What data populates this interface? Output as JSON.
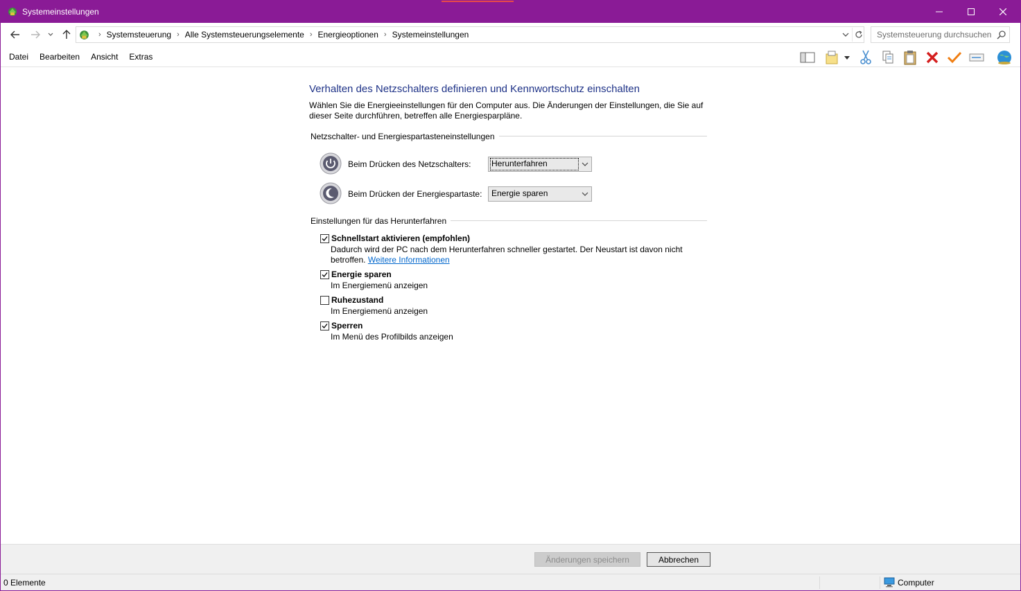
{
  "window": {
    "title": "Systemeinstellungen",
    "accent_color": "#8a1b96"
  },
  "address": {
    "crumbs": [
      "Systemsteuerung",
      "Alle Systemsteuerungselemente",
      "Energieoptionen",
      "Systemeinstellungen"
    ],
    "search_placeholder": "Systemsteuerung durchsuchen"
  },
  "menu": {
    "items": [
      "Datei",
      "Bearbeiten",
      "Ansicht",
      "Extras"
    ]
  },
  "toolbar": {
    "icons": [
      "layout-pane-icon",
      "new-folder-icon",
      "cut-icon",
      "copy-icon",
      "paste-icon",
      "delete-icon",
      "apply-check-icon",
      "rename-icon",
      "globe-icon"
    ]
  },
  "page": {
    "title": "Verhalten des Netzschalters definieren und Kennwortschutz einschalten",
    "description": "Wählen Sie die Energieeinstellungen für den Computer aus. Die Änderungen der Einstellungen, die Sie auf dieser Seite durchführen, betreffen alle Energiesparpläne.",
    "group1": {
      "label": "Netzschalter- und Energiespartasteneinstellungen",
      "power_button": {
        "label": "Beim Drücken des Netzschalters:",
        "value": "Herunterfahren"
      },
      "sleep_button": {
        "label": "Beim Drücken der Energiespartaste:",
        "value": "Energie sparen"
      }
    },
    "group2": {
      "label": "Einstellungen für das Herunterfahren",
      "options": [
        {
          "title": "Schnellstart aktivieren (empfohlen)",
          "desc": "Dadurch wird der PC nach dem Herunterfahren schneller gestartet. Der Neustart ist davon nicht betroffen.",
          "link": "Weitere Informationen",
          "checked": true
        },
        {
          "title": "Energie sparen",
          "desc": "Im Energiemenü anzeigen",
          "checked": true
        },
        {
          "title": "Ruhezustand",
          "desc": "Im Energiemenü anzeigen",
          "checked": false
        },
        {
          "title": "Sperren",
          "desc": "Im Menü des Profilbilds anzeigen",
          "checked": true
        }
      ]
    }
  },
  "buttons": {
    "save": "Änderungen speichern",
    "cancel": "Abbrechen"
  },
  "status": {
    "items": "0 Elemente",
    "zone": "Computer"
  }
}
